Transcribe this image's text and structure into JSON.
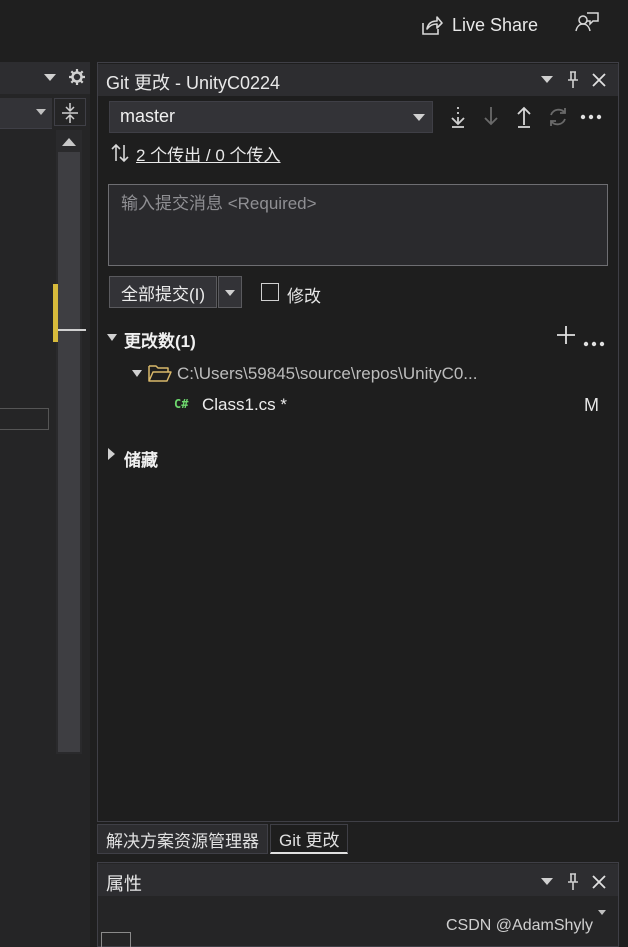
{
  "topbar": {
    "live_share_label": "Live Share",
    "icons": [
      "live-share-icon",
      "feedback-icon"
    ]
  },
  "left_pane": {
    "icons": [
      "chevron-down-icon",
      "gear-icon",
      "split-icon",
      "scroll-up-icon"
    ]
  },
  "git_panel": {
    "title": "Git 更改 - UnityC0224",
    "branch": "master",
    "toolbar_icons": [
      "fetch-icon",
      "pull-icon",
      "push-icon",
      "sync-icon",
      "more-icon"
    ],
    "sync_status": "2 个传出 / 0 个传入",
    "commit_placeholder": "输入提交消息 <Required>",
    "commit_all_label": "全部提交(I)",
    "amend_label": "修改",
    "changes_header": "更改数(1)",
    "folder_path": "C:\\Users\\59845\\source\\repos\\UnityC0...",
    "file": {
      "icon_text": "C#",
      "name": "Class1.cs *",
      "status": "M"
    },
    "stashes_header": "储藏"
  },
  "tabs": [
    {
      "label": "解决方案资源管理器",
      "active": false
    },
    {
      "label": "Git 更改",
      "active": true
    }
  ],
  "properties": {
    "title": "属性"
  },
  "watermark": "CSDN @AdamShyly",
  "colors": {
    "background": "#1f1f1f",
    "panel": "#1e1e1e",
    "header": "#2d2d30",
    "scroll_marker": "#d7ba3b",
    "csharp_icon": "#6ed86e"
  }
}
